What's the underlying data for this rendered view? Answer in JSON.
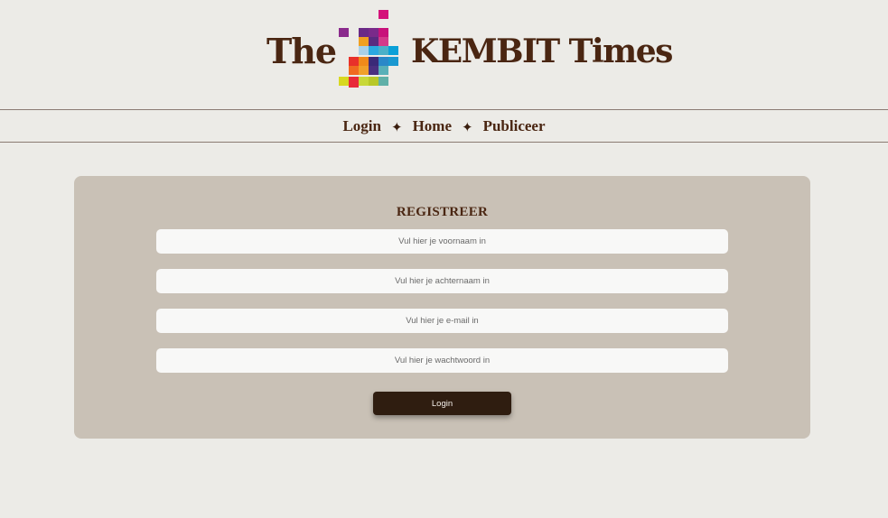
{
  "masthead": {
    "the": "The",
    "name": "KEMBIT Times"
  },
  "nav": {
    "items": [
      {
        "label": "Login"
      },
      {
        "label": "Home"
      },
      {
        "label": "Publiceer"
      }
    ],
    "separator": "✦"
  },
  "form": {
    "title": "REGISTREER",
    "fields": [
      {
        "placeholder": "Vul hier je voornaam in",
        "value": ""
      },
      {
        "placeholder": "Vul hier je achternaam in",
        "value": ""
      },
      {
        "placeholder": "Vul hier je e-mail in",
        "value": ""
      },
      {
        "placeholder": "Vul hier je wachtwoord in",
        "value": ""
      }
    ],
    "submit_label": "Login"
  },
  "colors": {
    "background": "#ecebe7",
    "brand_brown": "#4a2612",
    "card": "#c9c1b6",
    "button": "#2f1d10"
  }
}
